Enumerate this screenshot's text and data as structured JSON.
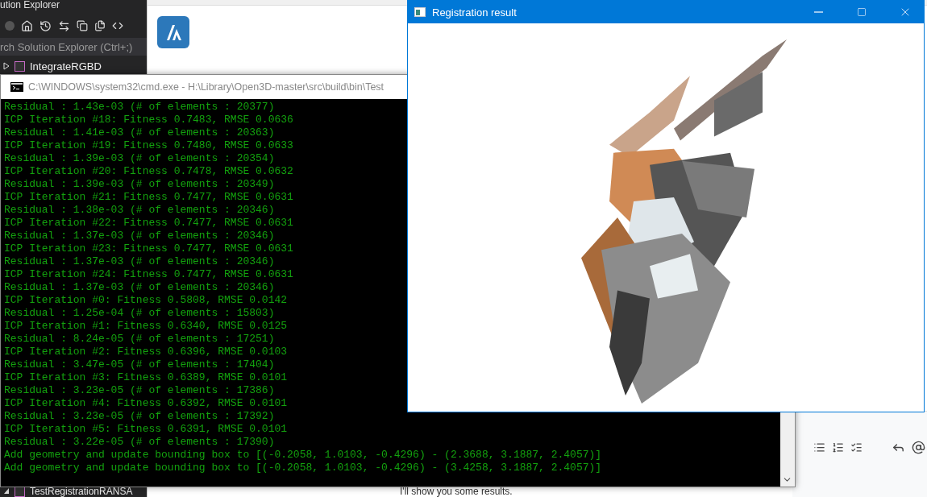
{
  "solution_explorer": {
    "title": "ution Explorer",
    "search": {
      "placeholder": "rch Solution Explorer (Ctrl+;)"
    },
    "items": [
      {
        "label": "IntegrateRGBD",
        "expanded": false
      },
      {
        "label": "TestRegistrationRANSA",
        "expanded": true
      }
    ]
  },
  "browser": {
    "message": "I'll show you some results."
  },
  "console": {
    "title": "C:\\WINDOWS\\system32\\cmd.exe - H:\\Library\\Open3D-master\\src\\build\\bin\\Test",
    "lines": [
      "Residual : 1.43e-03 (# of elements : 20377)",
      "ICP Iteration #18: Fitness 0.7483, RMSE 0.0636",
      "Residual : 1.41e-03 (# of elements : 20363)",
      "ICP Iteration #19: Fitness 0.7480, RMSE 0.0633",
      "Residual : 1.39e-03 (# of elements : 20354)",
      "ICP Iteration #20: Fitness 0.7478, RMSE 0.0632",
      "Residual : 1.39e-03 (# of elements : 20349)",
      "ICP Iteration #21: Fitness 0.7477, RMSE 0.0631",
      "Residual : 1.38e-03 (# of elements : 20346)",
      "ICP Iteration #22: Fitness 0.7477, RMSE 0.0631",
      "Residual : 1.37e-03 (# of elements : 20346)",
      "ICP Iteration #23: Fitness 0.7477, RMSE 0.0631",
      "Residual : 1.37e-03 (# of elements : 20346)",
      "ICP Iteration #24: Fitness 0.7477, RMSE 0.0631",
      "Residual : 1.37e-03 (# of elements : 20346)",
      "ICP Iteration #0: Fitness 0.5808, RMSE 0.0142",
      "Residual : 1.25e-04 (# of elements : 15803)",
      "ICP Iteration #1: Fitness 0.6340, RMSE 0.0125",
      "Residual : 8.24e-05 (# of elements : 17251)",
      "ICP Iteration #2: Fitness 0.6396, RMSE 0.0103",
      "Residual : 3.47e-05 (# of elements : 17404)",
      "ICP Iteration #3: Fitness 0.6389, RMSE 0.0101",
      "Residual : 3.23e-05 (# of elements : 17386)",
      "ICP Iteration #4: Fitness 0.6392, RMSE 0.0101",
      "Residual : 3.23e-05 (# of elements : 17392)",
      "ICP Iteration #5: Fitness 0.6391, RMSE 0.0101",
      "Residual : 3.22e-05 (# of elements : 17390)",
      "Add geometry and update bounding box to [(-0.2058, 1.0103, -0.4296) - (2.3688, 3.1887, 2.4057)]",
      "Add geometry and update bounding box to [(-0.2058, 1.0103, -0.4296) - (3.4258, 3.1887, 2.4057)]"
    ]
  },
  "viewer": {
    "title": "Registration result"
  }
}
